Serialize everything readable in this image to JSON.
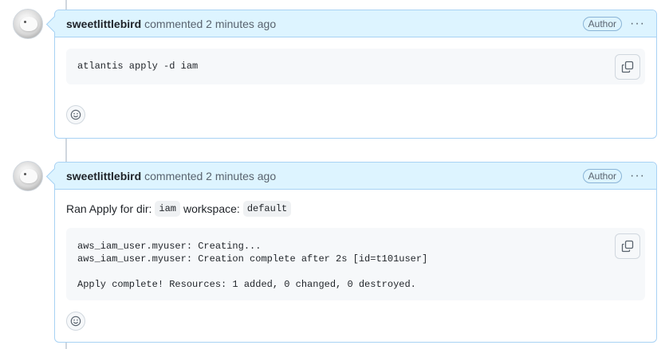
{
  "comments": [
    {
      "author": "sweetlittlebird",
      "action_text": "commented 2 minutes ago",
      "badge": "Author",
      "more_label": "···",
      "body": {
        "code_lines": [
          "atlantis apply -d iam"
        ]
      }
    },
    {
      "author": "sweetlittlebird",
      "action_text": "commented 2 minutes ago",
      "badge": "Author",
      "more_label": "···",
      "body": {
        "intro_prefix": "Ran Apply for dir:",
        "dir_value": "iam",
        "workspace_label": "workspace:",
        "workspace_value": "default",
        "code_lines": [
          "aws_iam_user.myuser: Creating...",
          "aws_iam_user.myuser: Creation complete after 2s [id=t101user]",
          "",
          "Apply complete! Resources: 1 added, 0 changed, 0 destroyed."
        ]
      }
    }
  ],
  "icons": {
    "copy": "copy-icon",
    "reaction": "smiley-icon",
    "more": "kebab-horizontal-icon"
  },
  "colors": {
    "header_bg": "#ddf4ff",
    "border": "#a8d2f4",
    "code_bg": "#f6f8fa"
  }
}
